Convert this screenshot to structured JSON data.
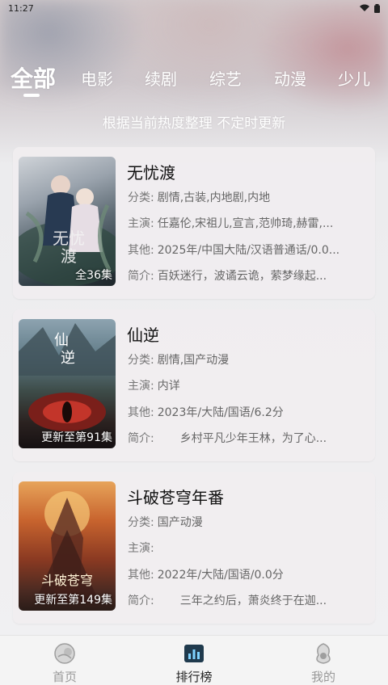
{
  "status_bar": {
    "time": "11:27"
  },
  "tabs": [
    {
      "label": "全部",
      "active": true
    },
    {
      "label": "电影",
      "active": false
    },
    {
      "label": "续剧",
      "active": false
    },
    {
      "label": "综艺",
      "active": false
    },
    {
      "label": "动漫",
      "active": false
    },
    {
      "label": "少儿",
      "active": false
    }
  ],
  "subtitle": "根据当前热度整理 不定时更新",
  "items": [
    {
      "title": "无忧渡",
      "episode": "全36集",
      "poster_text": "无忧渡",
      "category_label": "分类:",
      "category": "剧情,古装,内地剧,内地",
      "cast_label": "主演:",
      "cast": "任嘉伦,宋祖儿,宣言,范帅琦,赫雷,...",
      "other_label": "其他:",
      "other": "2025年/中国大陆/汉语普通话/0.0...",
      "intro_label": "简介:",
      "intro": "百妖迷行，波谲云诡，萦梦缘起..."
    },
    {
      "title": "仙逆",
      "episode": "更新至第91集",
      "poster_text": "仙逆",
      "category_label": "分类:",
      "category": "剧情,国产动漫",
      "cast_label": "主演:",
      "cast": "内详",
      "other_label": "其他:",
      "other": "2023年/大陆/国语/6.2分",
      "intro_label": "简介:",
      "intro": "乡村平凡少年王林，为了心..."
    },
    {
      "title": "斗破苍穹年番",
      "episode": "更新至第149集",
      "poster_text": "斗破苍穹",
      "category_label": "分类:",
      "category": "国产动漫",
      "cast_label": "主演:",
      "cast": "",
      "other_label": "其他:",
      "other": "2022年/大陆/国语/0.0分",
      "intro_label": "简介:",
      "intro": "三年之约后，萧炎终于在迦..."
    }
  ],
  "bottom_nav": [
    {
      "label": "首页",
      "icon": "home-icon",
      "active": false
    },
    {
      "label": "排行榜",
      "icon": "ranking-icon",
      "active": true
    },
    {
      "label": "我的",
      "icon": "profile-icon",
      "active": false
    }
  ]
}
